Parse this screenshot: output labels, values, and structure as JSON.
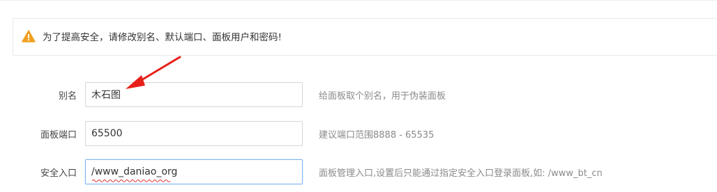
{
  "warning": {
    "icon": "warning-triangle-icon",
    "text": "为了提高安全，请修改别名、默认端口、面板用户和密码!"
  },
  "fields": [
    {
      "label": "别名",
      "value": "木石图",
      "hint": "给面板取个别名，用于伪装面板"
    },
    {
      "label": "面板端口",
      "value": "65500",
      "hint": "建议端口范围8888 - 65535"
    },
    {
      "label": "安全入口",
      "value": "/www_daniao_org",
      "hint": "面板管理入口,设置后只能通过指定安全入口登录面板,如: /www_bt_cn"
    }
  ],
  "colors": {
    "warning_icon": "#f0a020",
    "annotation_arrow": "#e8201a",
    "active_border": "#7fb6ef",
    "spellcheck_underline": "#e03030"
  }
}
